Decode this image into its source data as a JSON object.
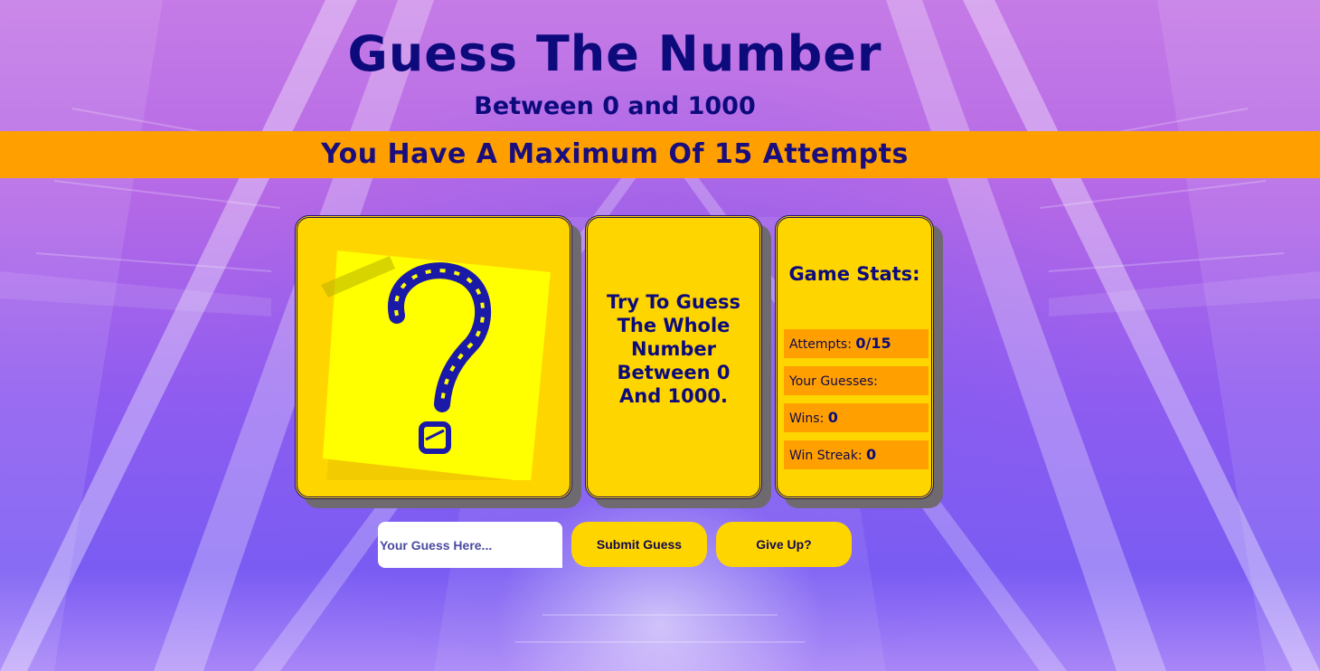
{
  "header": {
    "title": "Guess The Number",
    "subtitle": "Between 0 and 1000"
  },
  "banner": {
    "text": "You Have A Maximum Of 15 Attempts"
  },
  "cards": {
    "instruction": "Try To Guess The Whole Number Between 0 And 1000."
  },
  "stats": {
    "title": "Game Stats:",
    "attempts_label": "Attempts:",
    "attempts_value": "0/15",
    "guesses_label": "Your Guesses:",
    "guesses_value": "",
    "wins_label": "Wins:",
    "wins_value": "0",
    "streak_label": "Win Streak:",
    "streak_value": "0"
  },
  "controls": {
    "guess_placeholder": "Your Guess Here...",
    "guess_value": "",
    "submit_label": "Submit Guess",
    "giveup_label": "Give Up?"
  },
  "icons": {
    "mystery": "question-mark-sticky-note-icon"
  },
  "colors": {
    "banner": "#ffa000",
    "card": "#ffd500",
    "text": "#0d0b7c",
    "sticky_note": "#ffff00"
  }
}
